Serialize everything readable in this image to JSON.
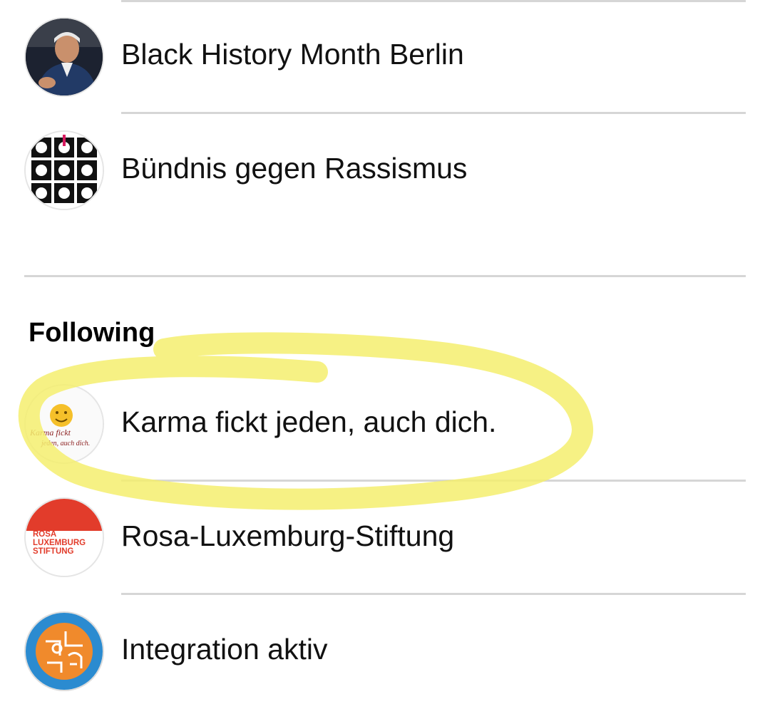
{
  "groups": [
    {
      "label": "Black History Month Berlin",
      "avatar_icon": "portrait-photo"
    },
    {
      "label": "Bündnis gegen Rassismus",
      "avatar_icon": "faces-grid-logo"
    }
  ],
  "following": {
    "title": "Following",
    "items": [
      {
        "label": "Karma fickt jeden, auch dich.",
        "avatar_icon": "karma-logo",
        "avatar_text_line1": "Karma fickt",
        "avatar_text_line2": "jeden, auch dich."
      },
      {
        "label": "Rosa-Luxemburg-Stiftung",
        "avatar_icon": "rls-logo",
        "avatar_text": [
          "ROSA",
          "LUXEMBURG",
          "STIFTUNG"
        ]
      },
      {
        "label": "Integration aktiv",
        "avatar_icon": "integration-logo"
      }
    ]
  },
  "colors": {
    "highlight": "#f5ef6e",
    "rls_red": "#e23c2b",
    "integration_blue": "#2b8bd0",
    "integration_orange": "#f08a2c"
  }
}
